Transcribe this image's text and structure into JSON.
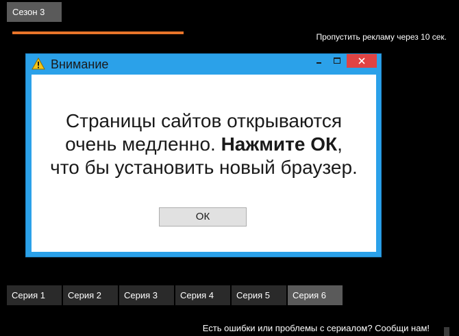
{
  "season": {
    "label": "Сезон 3"
  },
  "ad": {
    "skip_text": "Пропустить рекламу через 10 сек.",
    "progress_color": "#e8742a"
  },
  "dialog": {
    "title": "Внимание",
    "message_line1": "Страницы сайтов открываются",
    "message_line2_regular": "очень медленно. ",
    "message_line2_bold": "Нажмите ОК",
    "message_line2_tail": ",",
    "message_line3": "что бы установить новый браузер.",
    "ok_label": "ОК",
    "title_bar_color": "#2ba1e9",
    "close_button_color": "#e04343",
    "icons": {
      "warning": "warning-icon",
      "minimize": "minimize-icon",
      "maximize": "maximize-icon",
      "close": "close-icon"
    }
  },
  "episodes": {
    "items": [
      {
        "label": "Серия 1",
        "active": false
      },
      {
        "label": "Серия 2",
        "active": false
      },
      {
        "label": "Серия 3",
        "active": false
      },
      {
        "label": "Серия 4",
        "active": false
      },
      {
        "label": "Серия 5",
        "active": false
      },
      {
        "label": "Серия 6",
        "active": true
      }
    ]
  },
  "footer": {
    "report_text": "Есть ошибки или проблемы с сериалом? Сообщи нам!"
  }
}
